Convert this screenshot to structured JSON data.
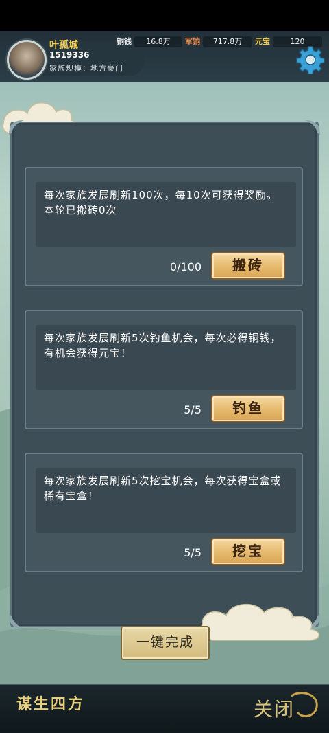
{
  "player": {
    "name": "叶孤城",
    "id": "1519336",
    "clan_scale": "家族规模：地方豪门"
  },
  "resources": [
    {
      "label": "铜钱",
      "value": "16.8万",
      "color": "#e6e6e6"
    },
    {
      "label": "军饷",
      "value": "717.8万",
      "color": "#f08a4b"
    },
    {
      "label": "元宝",
      "value": "120",
      "color": "#f2c84a"
    }
  ],
  "tasks": [
    {
      "description": "每次家族发展刷新100次，每10次可获得奖励。本轮已搬砖0次",
      "count": "0/100",
      "button": "搬砖"
    },
    {
      "description": "每次家族发展刷新5次钓鱼机会，每次必得铜钱，有机会获得元宝！",
      "count": "5/5",
      "button": "钓鱼"
    },
    {
      "description": "每次家族发展刷新5次挖宝机会，每次获得宝盒或稀有宝盒！",
      "count": "5/5",
      "button": "挖宝"
    }
  ],
  "complete_all_button": "一键完成",
  "footer": {
    "title": "谋生四方",
    "back_button": "关闭"
  }
}
